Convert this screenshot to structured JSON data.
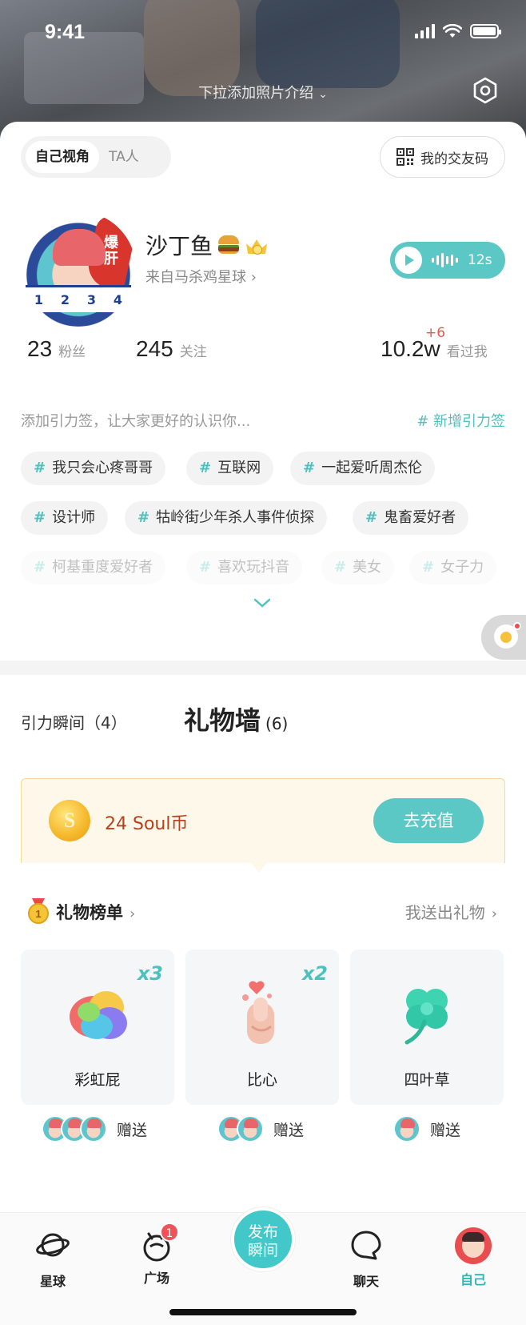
{
  "status_bar": {
    "time": "9:41"
  },
  "header": {
    "pull_hint": "下拉添加照片介绍"
  },
  "profile": {
    "view_toggle": [
      "自己视角",
      "TA人"
    ],
    "qr_button": "我的交友码",
    "nickname": "沙丁鱼",
    "avatar_text": "爆肝",
    "avatar_cards": [
      "1",
      "2",
      "3",
      "4"
    ],
    "origin": "来自马杀鸡星球 ›",
    "voice_duration": "12s",
    "stats": {
      "fans_num": "23",
      "fans_label": "粉丝",
      "follow_num": "245",
      "follow_label": "关注",
      "views_num": "10.2w",
      "views_delta": "+6",
      "views_label": "看过我"
    }
  },
  "tags": {
    "hint": "添加引力签，让大家更好的认识你...",
    "add_label": "# 新增引力签",
    "hash": "#",
    "items": [
      "我只会心疼哥哥",
      "互联网",
      "一起爱听周杰伦",
      "设计师",
      "牯岭街少年杀人事件侦探",
      "鬼畜爱好者",
      "柯基重度爱好者",
      "喜欢玩抖音",
      "美女",
      "女子力"
    ]
  },
  "tabs": {
    "moments": "引力瞬间（4）",
    "gift_wall": "礼物墙",
    "gift_wall_count": "(6)"
  },
  "coins": {
    "balance_text": "24  Soul币",
    "recharge_label": "去充值"
  },
  "gift_rank": {
    "title": "礼物榜单",
    "sent_label": "我送出礼物",
    "medal_num": "1",
    "give_label": "赠送",
    "gifts": [
      {
        "name": "彩虹屁",
        "count": "x3",
        "givers": 3
      },
      {
        "name": "比心",
        "count": "x2",
        "givers": 2
      },
      {
        "name": "四叶草",
        "count": "",
        "givers": 1
      }
    ]
  },
  "bottom_nav": {
    "planet": "星球",
    "square": "广场",
    "square_badge": "1",
    "publish": "发布瞬间",
    "chat": "聊天",
    "me": "自己"
  },
  "colors": {
    "accent": "#4ec1bf",
    "button": "#5cc8c6",
    "badge": "#ef5258",
    "coin_text": "#b6411c"
  }
}
